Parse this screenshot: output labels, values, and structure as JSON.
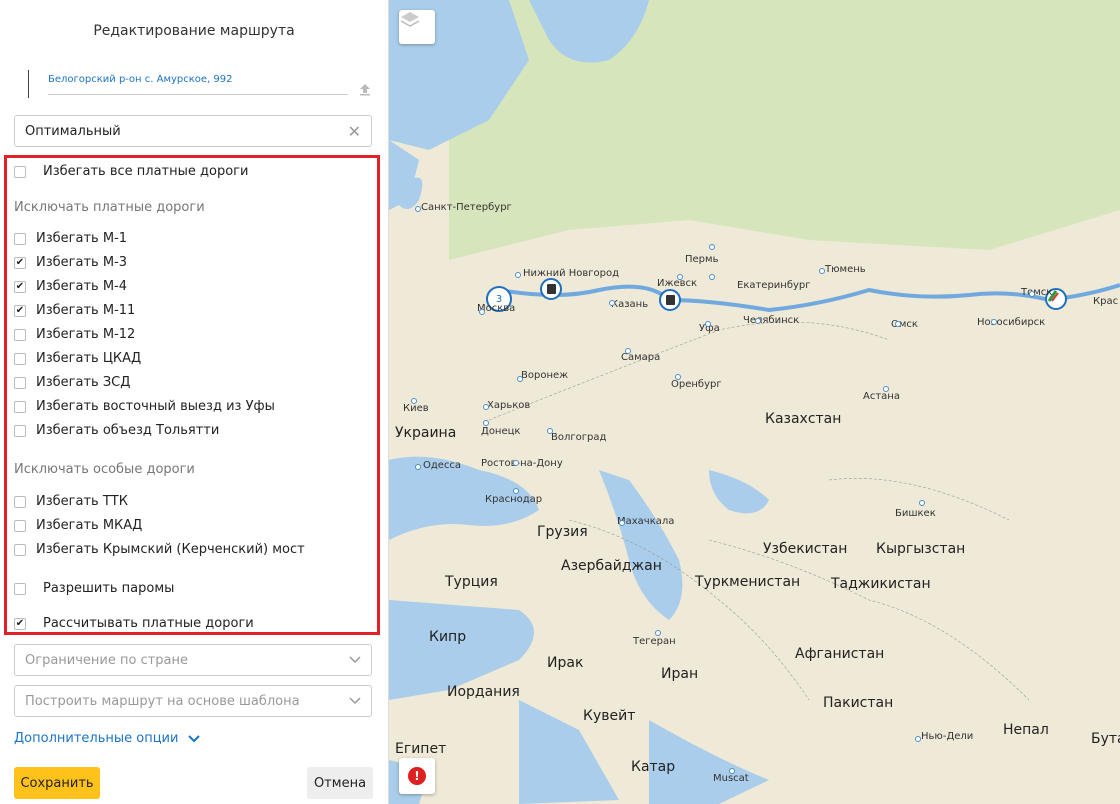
{
  "panel": {
    "title": "Редактирование маршрута",
    "address": "Белогорский р-он с. Амурское, 992",
    "mode": "Оптимальный",
    "avoid_all_toll": {
      "label": "Избегать все платные дороги",
      "checked": false
    },
    "toll_section": "Исключать платные дороги",
    "toll_roads": [
      {
        "label": "Избегать М-1",
        "checked": false
      },
      {
        "label": "Избегать М-3",
        "checked": true
      },
      {
        "label": "Избегать М-4",
        "checked": true
      },
      {
        "label": "Избегать М-11",
        "checked": true
      },
      {
        "label": "Избегать М-12",
        "checked": false
      },
      {
        "label": "Избегать ЦКАД",
        "checked": false
      },
      {
        "label": "Избегать ЗСД",
        "checked": false
      },
      {
        "label": "Избегать восточный выезд из Уфы",
        "checked": false
      },
      {
        "label": "Избегать объезд Тольятти",
        "checked": false
      }
    ],
    "special_section": "Исключать особые дороги",
    "special_roads": [
      {
        "label": "Избегать ТТК",
        "checked": false
      },
      {
        "label": "Избегать МКАД",
        "checked": false
      },
      {
        "label": "Избегать Крымский (Керченский) мост",
        "checked": false
      }
    ],
    "allow_ferries": {
      "label": "Разрешить паромы",
      "checked": false
    },
    "calc_toll": {
      "label": "Рассчитывать платные дороги",
      "checked": true
    },
    "country_limit_placeholder": "Ограничение по стране",
    "template_placeholder": "Построить маршрут на основе шаблона",
    "more_options": "Дополнительные опции",
    "save": "Сохранить",
    "cancel": "Отмена",
    "check_mark": "✔",
    "clear_glyph": "✕"
  },
  "map": {
    "marker_count": "3",
    "error_glyph": "!",
    "cities": [
      "Санкт-Петербург",
      "Нижний Новгород",
      "Пермь",
      "Москва",
      "Казань",
      "Ижевск",
      "Екатеринбург",
      "Тюмень",
      "Уфа",
      "Челябинск",
      "Омск",
      "Новосибирск",
      "Томск",
      "Самара",
      "Воронеж",
      "Оренбург",
      "Астана",
      "Харьков",
      "Донецк",
      "Волгоград",
      "Ростов-на-Дону",
      "Одесса",
      "Краснодар",
      "Махачкала",
      "Бишкек",
      "Тегеран",
      "Нью-Дели",
      "Muscat",
      "Киев",
      "Крас"
    ],
    "countries": [
      "Украина",
      "Казахстан",
      "Грузия",
      "Азербайджан",
      "Узбекистан",
      "Кыргызстан",
      "Турция",
      "Туркменистан",
      "Таджикистан",
      "Кипр",
      "Ирак",
      "Иран",
      "Афганистан",
      "Иордания",
      "Пакистан",
      "Кувейт",
      "Непал",
      "Египет",
      "Катар",
      "Бутан"
    ],
    "colors": {
      "route": "#5a9ee0",
      "water": "#a9cdea",
      "land": "#efe9d7",
      "green": "#cfe3b4",
      "accent": "#ffc21a",
      "highlight": "#e0202a"
    }
  }
}
